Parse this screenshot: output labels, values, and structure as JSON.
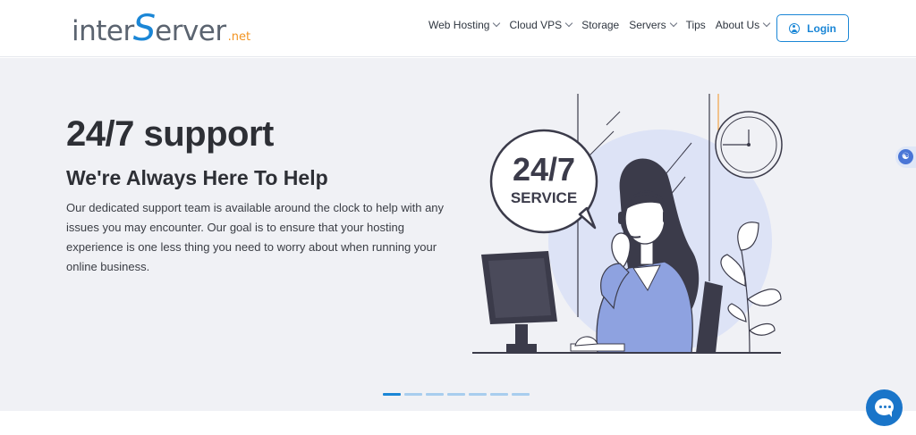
{
  "logo": {
    "part1": "inter",
    "part2": "S",
    "part3": "erver",
    "part4": ".net"
  },
  "nav": {
    "items": [
      {
        "label": "Web Hosting",
        "dropdown": true
      },
      {
        "label": "Cloud VPS",
        "dropdown": true
      },
      {
        "label": "Storage",
        "dropdown": false
      },
      {
        "label": "Servers",
        "dropdown": true
      },
      {
        "label": "Tips",
        "dropdown": false
      },
      {
        "label": "About Us",
        "dropdown": true
      }
    ],
    "login_label": "Login"
  },
  "hero": {
    "title": "24/7 support",
    "subtitle": "We're Always Here To Help",
    "body": "Our dedicated support team is available around the clock to help with any issues you may encounter. Our goal is to ensure that your hosting experience is one less thing you need to worry about when running your online business.",
    "badge_line1": "24/7",
    "badge_line2": "SERVICE"
  },
  "carousel": {
    "slide_count": 7,
    "active_index": 0
  },
  "colors": {
    "brand_blue": "#1a86d6",
    "brand_orange": "#f29422",
    "hero_bg": "#f0f1f5",
    "headline": "#2d2f35",
    "illustration_accent": "#7b93d8"
  },
  "icons": {
    "login": "user-circle-icon",
    "accessibility": "accessibility-icon",
    "chat": "chat-bubble-icon",
    "dropdown": "chevron-down-icon"
  }
}
